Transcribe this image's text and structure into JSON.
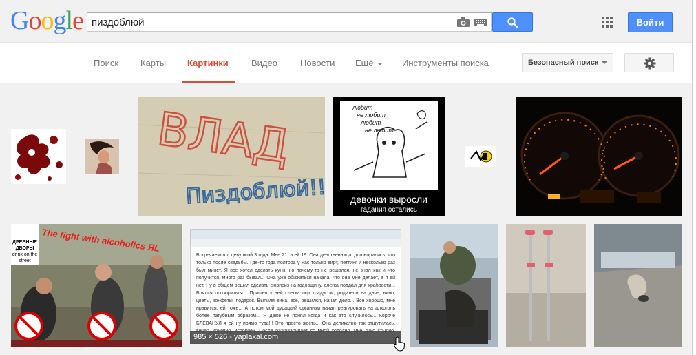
{
  "header": {
    "logo_text": "Google",
    "search_query": "пиздоблюй",
    "signin_label": "Войти"
  },
  "nav": {
    "tabs": [
      {
        "label": "Поиск"
      },
      {
        "label": "Карты"
      },
      {
        "label": "Картинки"
      },
      {
        "label": "Видео"
      },
      {
        "label": "Новости"
      },
      {
        "label": "Ещё"
      },
      {
        "label": "Инструменты поиска"
      }
    ],
    "safe_search_label": "Безопасный поиск"
  },
  "images": {
    "wall_text_1": "ВЛАД",
    "wall_text_2": "Пиздоблюй!!!",
    "cartoon_lines": [
      "любит",
      "не любит",
      "любит",
      "не любит"
    ],
    "cartoon_caption": "девочки выросли",
    "cartoon_subcaption": "гадания остались",
    "meme_caption": "The fight with alcoholics ЯL",
    "meme_logo": "ДРЕВНЫЕ ДВОРЫ",
    "meme_logo_sub": "drink on the street",
    "forum_text": "Встречаемся с девушкой 3 года. Мне 21, а ей 19. Она девственница, договорились, что только после свадьбы. Где-то года полтора у нас только вирт, петтинг и несколько раз был минет. Я все хотел сделать кунн, но почему-то не решался, не знал как и что получится, много раз бывал... Она уже обижаться начала, что она мне делает, а я ей нет. Ну в общем решил сделать сюрприз на годовщину, слегка поддал для храбрости... Боялся опозориться... Пришел к ней слегка под градусом, родители на даче, вино, цветы, конфеты, подарок. Выпили вина, все, решился, начал дело... Все хорошо, мне нравится, ей тоже... А потом мой дурацкий организм начал реагировать на алкоголь более пагубным образом... Я даже не понял когда и как это случилось... Короче БЛЕВАНУЛ я ей ну прямо туда!!! Это просто жесть... Она деликатно так отшутилась, вечер, конечно, испорчен. После разговаривает со мной холодно, мне дико стыдно, хочется просто",
    "hover_caption": "985 × 526 - yaplakal.com"
  },
  "colors": {
    "accent_blue": "#4d90fe",
    "active_tab_red": "#dd4b39"
  }
}
